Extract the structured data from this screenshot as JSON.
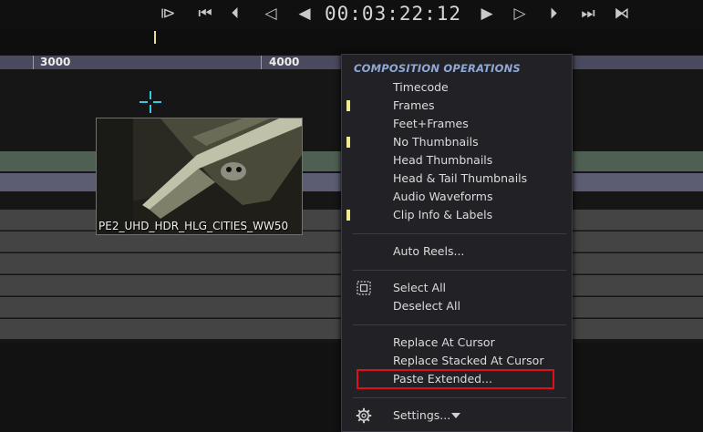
{
  "transport": {
    "buttons": [
      {
        "name": "mark-in-button",
        "glyph": "⧐"
      },
      {
        "name": "go-to-start-button",
        "glyph": "⏮"
      },
      {
        "name": "previous-edit-button",
        "glyph": "⏴"
      },
      {
        "name": "step-back-button",
        "glyph": "◁"
      },
      {
        "name": "play-reverse-button",
        "glyph": "◀"
      },
      {
        "name": "play-button",
        "glyph": "▶"
      },
      {
        "name": "step-forward-button",
        "glyph": "▷"
      },
      {
        "name": "next-edit-button",
        "glyph": "⏵"
      },
      {
        "name": "go-to-end-button",
        "glyph": "⏭"
      },
      {
        "name": "mark-out-button",
        "glyph": "⧑"
      }
    ],
    "timecode": "00:03:22:12"
  },
  "ruler": {
    "labels": [
      "3000",
      "4000"
    ]
  },
  "clip": {
    "label": "PE2_UHD_HDR_HLG_CITIES_WW50"
  },
  "menu": {
    "title": "COMPOSITION OPERATIONS",
    "items": [
      {
        "label": "Timecode",
        "checked": false
      },
      {
        "label": "Frames",
        "checked": true
      },
      {
        "label": "Feet+Frames",
        "checked": false
      },
      {
        "label": "No Thumbnails",
        "checked": true
      },
      {
        "label": "Head Thumbnails",
        "checked": false
      },
      {
        "label": "Head & Tail Thumbnails",
        "checked": false
      },
      {
        "label": "Audio Waveforms",
        "checked": false
      },
      {
        "label": "Clip Info & Labels",
        "checked": true
      }
    ],
    "auto_reels": "Auto Reels...",
    "select_all": "Select All",
    "deselect_all": "Deselect All",
    "replace_at_cursor": "Replace At Cursor",
    "replace_stacked": "Replace Stacked At Cursor",
    "paste_extended": "Paste Extended...",
    "settings": "Settings...",
    "select_all_icon": "select-all-icon",
    "settings_icon": "gear-icon"
  },
  "colors": {
    "accent_check": "#f2ea8e",
    "menu_title": "#8fa8d6",
    "highlight": "#e0101a",
    "crosshair": "#39c8e0"
  }
}
